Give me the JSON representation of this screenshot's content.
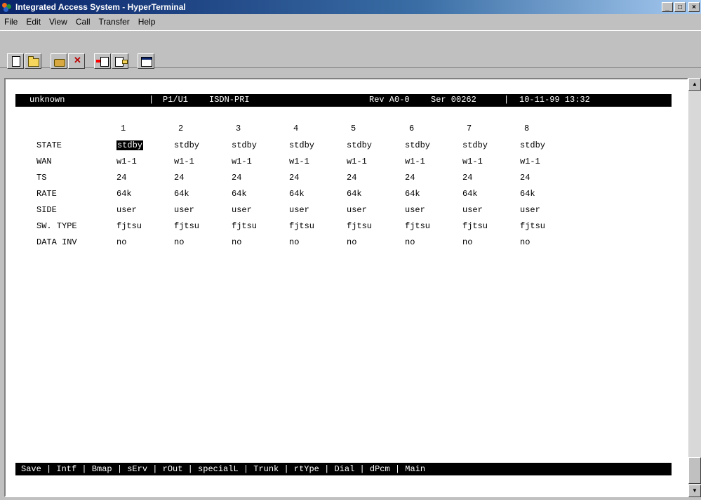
{
  "window": {
    "title": "Integrated Access System - HyperTerminal",
    "buttons": {
      "minimize": "_",
      "maximize": "□",
      "close": "×"
    }
  },
  "menu": [
    "File",
    "Edit",
    "View",
    "Call",
    "Transfer",
    "Help"
  ],
  "toolbar": {
    "icons": [
      "new-document-icon",
      "open-folder-icon",
      "connect-phone-icon",
      "disconnect-icon",
      "send-file-icon",
      "receive-file-icon",
      "properties-icon"
    ]
  },
  "terminal": {
    "status": {
      "name": "unknown",
      "slot": "P1/U1",
      "card": "ISDN-PRI",
      "rev": "Rev A0-0",
      "ser": "Ser 00262",
      "datetime": "10-11-99 13:32"
    },
    "columns": [
      "1",
      "2",
      "3",
      "4",
      "5",
      "6",
      "7",
      "8"
    ],
    "rows": [
      {
        "label": "STATE",
        "values": [
          "stdby",
          "stdby",
          "stdby",
          "stdby",
          "stdby",
          "stdby",
          "stdby",
          "stdby"
        ]
      },
      {
        "label": "WAN",
        "values": [
          "w1-1",
          "w1-1",
          "w1-1",
          "w1-1",
          "w1-1",
          "w1-1",
          "w1-1",
          "w1-1"
        ]
      },
      {
        "label": "TS",
        "values": [
          "24",
          "24",
          "24",
          "24",
          "24",
          "24",
          "24",
          "24"
        ]
      },
      {
        "label": "RATE",
        "values": [
          "64k",
          "64k",
          "64k",
          "64k",
          "64k",
          "64k",
          "64k",
          "64k"
        ]
      },
      {
        "label": "SIDE",
        "values": [
          "user",
          "user",
          "user",
          "user",
          "user",
          "user",
          "user",
          "user"
        ]
      },
      {
        "label": "SW. TYPE",
        "values": [
          "fjtsu",
          "fjtsu",
          "fjtsu",
          "fjtsu",
          "fjtsu",
          "fjtsu",
          "fjtsu",
          "fjtsu"
        ]
      },
      {
        "label": "DATA INV",
        "values": [
          "no",
          "no",
          "no",
          "no",
          "no",
          "no",
          "no",
          "no"
        ]
      }
    ],
    "commands": "Save | Intf | Bmap | sErv | rOut | specialL | Trunk | rtYpe | Dial | dPcm | Main"
  }
}
